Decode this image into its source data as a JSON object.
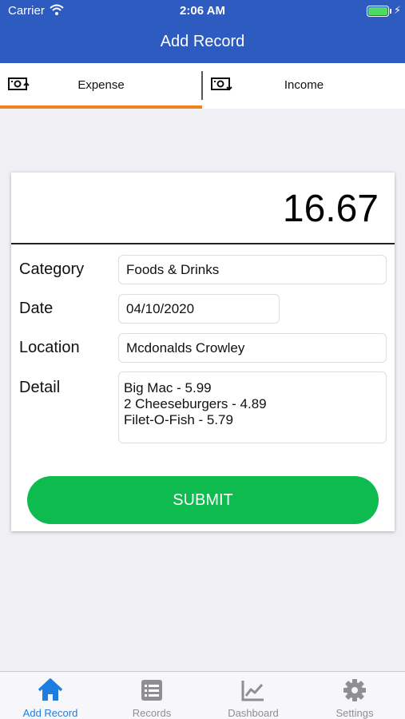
{
  "status_bar": {
    "carrier": "Carrier",
    "time": "2:06 AM"
  },
  "nav": {
    "title": "Add Record"
  },
  "tabs": [
    {
      "label": "Expense",
      "icon": "money-out-icon",
      "selected": true
    },
    {
      "label": "Income",
      "icon": "money-in-icon",
      "selected": false
    }
  ],
  "form": {
    "amount": "16.67",
    "category_label": "Category",
    "category_value": "Foods & Drinks",
    "date_label": "Date",
    "date_value": "04/10/2020",
    "location_label": "Location",
    "location_value": "Mcdonalds Crowley",
    "detail_label": "Detail",
    "detail_value": "Big Mac - 5.99\n2 Cheeseburgers - 4.89\nFilet-O-Fish - 5.79",
    "submit_label": "SUBMIT"
  },
  "bottom_tabs": [
    {
      "label": "Add Record",
      "icon": "home-icon",
      "active": true
    },
    {
      "label": "Records",
      "icon": "list-icon",
      "active": false
    },
    {
      "label": "Dashboard",
      "icon": "chart-icon",
      "active": false
    },
    {
      "label": "Settings",
      "icon": "gear-icon",
      "active": false
    }
  ],
  "colors": {
    "header": "#2d5bbf",
    "tab_indicator": "#f0821e",
    "submit": "#0dbb4f",
    "active_tab": "#1f7de0",
    "inactive_tab": "#8e8e93",
    "battery": "#4cd964"
  }
}
